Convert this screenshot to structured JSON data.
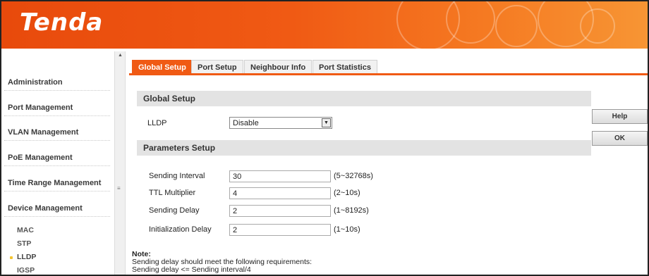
{
  "brand": {
    "logo": "Tenda"
  },
  "sidebar": {
    "items": [
      {
        "label": "Administration"
      },
      {
        "label": "Port Management"
      },
      {
        "label": "VLAN Management"
      },
      {
        "label": "PoE Management"
      },
      {
        "label": "Time Range Management"
      },
      {
        "label": "Device Management"
      }
    ],
    "subitems": [
      {
        "label": "MAC"
      },
      {
        "label": "STP"
      },
      {
        "label": "LLDP",
        "active": true
      },
      {
        "label": "IGSP"
      }
    ]
  },
  "tabs": [
    {
      "label": "Global Setup",
      "active": true
    },
    {
      "label": "Port Setup"
    },
    {
      "label": "Neighbour Info"
    },
    {
      "label": "Port Statistics"
    }
  ],
  "global": {
    "title": "Global Setup",
    "lldp_label": "LLDP",
    "lldp_value": "Disable"
  },
  "params": {
    "title": "Parameters Setup",
    "rows": [
      {
        "label": "Sending Interval",
        "value": "30",
        "range": "(5~32768s)"
      },
      {
        "label": "TTL Multiplier",
        "value": "4",
        "range": "(2~10s)"
      },
      {
        "label": "Sending Delay",
        "value": "2",
        "range": "(1~8192s)"
      },
      {
        "label": "Initialization Delay",
        "value": "2",
        "range": "(1~10s)"
      }
    ]
  },
  "note": {
    "title": "Note:",
    "line1": "Sending delay should meet the following requirements:",
    "line2": "Sending delay <= Sending interval/4"
  },
  "actions": {
    "help": "Help",
    "ok": "OK"
  },
  "colors": {
    "accent": "#f05a14",
    "section": "#e3e3e3"
  }
}
